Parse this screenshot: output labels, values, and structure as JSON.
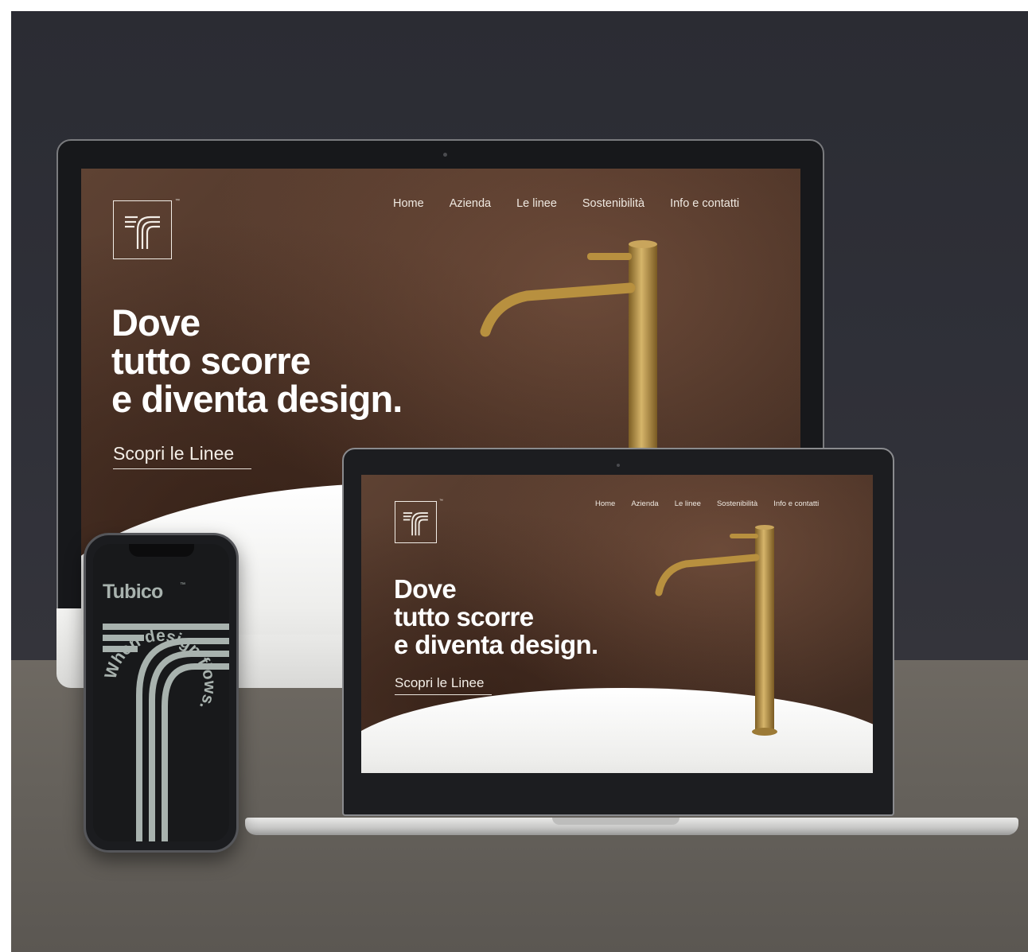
{
  "website": {
    "logo_icon": "stylized-T-lines-icon",
    "trademark": "™",
    "nav": [
      {
        "label": "Home"
      },
      {
        "label": "Azienda"
      },
      {
        "label": "Le linee"
      },
      {
        "label": "Sostenibilità"
      },
      {
        "label": "Info e contatti"
      }
    ],
    "headline": [
      "Dove",
      "tutto scorre",
      "e diventa design."
    ],
    "cta": "Scopri le Linee"
  },
  "phone": {
    "brand": "Tubico",
    "trademark": "™",
    "circular_text": "When design flows."
  },
  "colors": {
    "wall": "#2f3038",
    "desk": "#65615b",
    "brass": "#b8903f",
    "phone_accent": "#a8b2ae"
  }
}
